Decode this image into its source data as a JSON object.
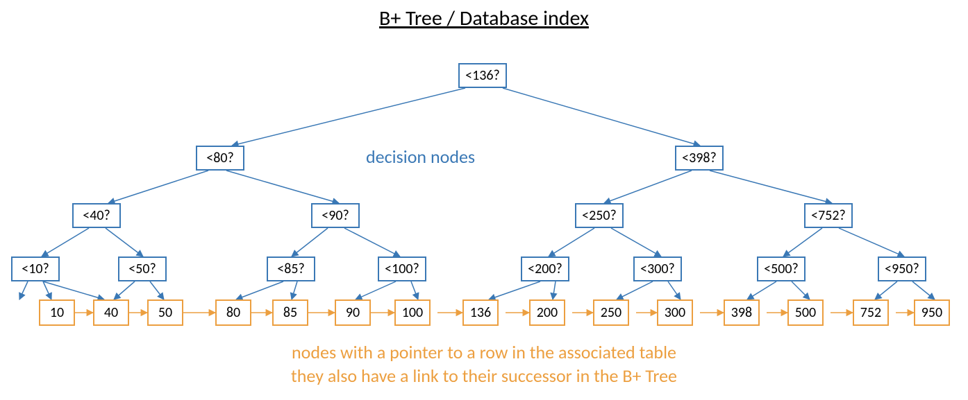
{
  "title": "B+ Tree / Database index",
  "label_decision": "decision nodes",
  "label_leaf_line1": "nodes with a pointer to a row in the associated table",
  "label_leaf_line2": "they also have a link to their successor in the B+ Tree",
  "colors": {
    "decision": "#3a78b5",
    "leaf": "#ec9f40"
  },
  "decision_nodes": {
    "root": "<136?",
    "l1a": "<80?",
    "l1b": "<398?",
    "l2a": "<40?",
    "l2b": "<90?",
    "l2c": "<250?",
    "l2d": "<752?",
    "l3a": "<10?",
    "l3b": "<50?",
    "l3c": "<85?",
    "l3d": "<100?",
    "l3e": "<200?",
    "l3f": "<300?",
    "l3g": "<500?",
    "l3h": "<950?"
  },
  "leaf_nodes": {
    "n0": "10",
    "n1": "40",
    "n2": "50",
    "n3": "80",
    "n4": "85",
    "n5": "90",
    "n6": "100",
    "n7": "136",
    "n8": "200",
    "n9": "250",
    "n10": "300",
    "n11": "398",
    "n12": "500",
    "n13": "752",
    "n14": "950"
  }
}
